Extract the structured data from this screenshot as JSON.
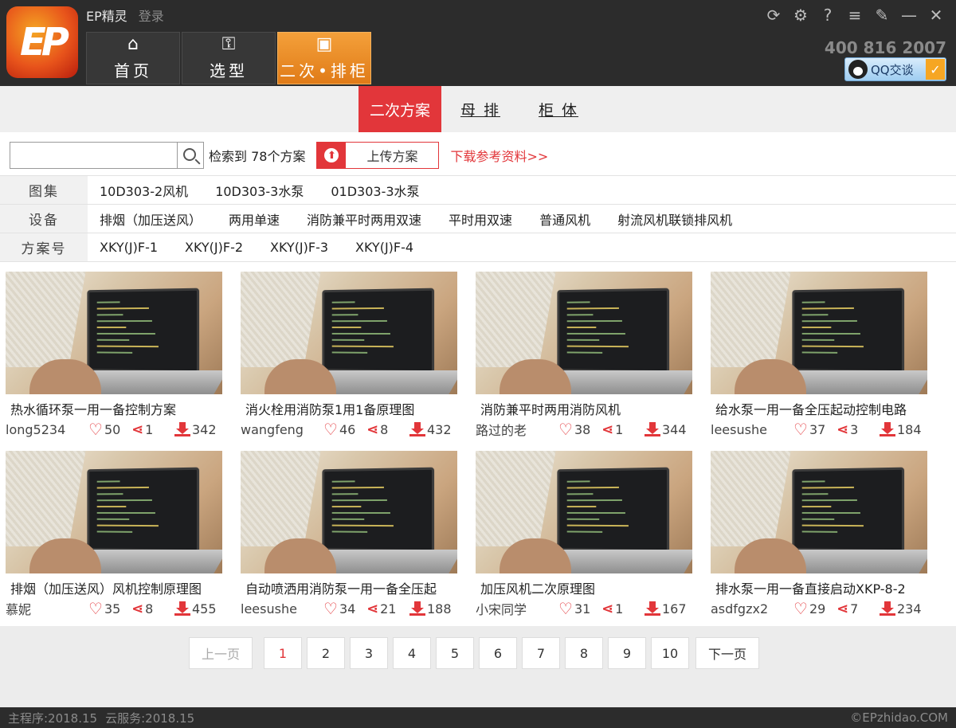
{
  "app": {
    "title": "EP精灵",
    "login": "登录",
    "logo_text": "EP",
    "hotline": "400 816 2007",
    "qq_label": "QQ交谈"
  },
  "window_controls": [
    {
      "name": "refresh-icon",
      "glyph": "⟳"
    },
    {
      "name": "settings-icon",
      "glyph": "⚙"
    },
    {
      "name": "help-icon",
      "glyph": "?"
    },
    {
      "name": "menu-dropdown-icon",
      "glyph": "≡"
    },
    {
      "name": "pin-icon",
      "glyph": "✎"
    },
    {
      "name": "minimize-icon",
      "glyph": "—"
    },
    {
      "name": "close-icon",
      "glyph": "✕"
    }
  ],
  "nav_tabs": [
    {
      "icon": "home-icon",
      "glyph": "⌂",
      "label": "首页"
    },
    {
      "icon": "selection-icon",
      "glyph": "⚿",
      "label": "选型"
    },
    {
      "icon": "cabinet-icon",
      "glyph": "▣",
      "label": "二次•排柜",
      "active": true
    }
  ],
  "sub_tabs": [
    {
      "label": "二次方案",
      "active": true
    },
    {
      "label": "母 排"
    },
    {
      "label": "柜 体"
    }
  ],
  "search": {
    "value": "",
    "placeholder": "",
    "result_count": "检索到 78个方案"
  },
  "upload_label": "上传方案",
  "download_link": "下载参考资料>>",
  "filters": [
    {
      "label": "图集",
      "options": [
        "10D303-2风机",
        "10D303-3水泵",
        "01D303-3水泵"
      ]
    },
    {
      "label": "设备",
      "options": [
        "排烟（加压送风）",
        "两用单速",
        "消防兼平时两用双速",
        "平时用双速",
        "普通风机",
        "射流风机联锁排风机"
      ]
    },
    {
      "label": "方案号",
      "options": [
        "XKY(J)F-1",
        "XKY(J)F-2",
        "XKY(J)F-3",
        "XKY(J)F-4"
      ]
    }
  ],
  "cards": [
    {
      "title": "热水循环泵一用一备控制方案",
      "author": "long5234",
      "likes": "50",
      "shares": "1",
      "downloads": "342"
    },
    {
      "title": "消火栓用消防泵1用1备原理图",
      "author": "wangfeng",
      "likes": "46",
      "shares": "8",
      "downloads": "432"
    },
    {
      "title": "消防兼平时两用消防风机",
      "author": "路过的老",
      "likes": "38",
      "shares": "1",
      "downloads": "344"
    },
    {
      "title": "给水泵一用一备全压起动控制电路",
      "author": "leesushe",
      "likes": "37",
      "shares": "3",
      "downloads": "184"
    },
    {
      "title": "排烟（加压送风）风机控制原理图",
      "author": "慕妮",
      "likes": "35",
      "shares": "8",
      "downloads": "455"
    },
    {
      "title": "自动喷洒用消防泵一用一备全压起",
      "author": "leesushe",
      "likes": "34",
      "shares": "21",
      "downloads": "188"
    },
    {
      "title": "加压风机二次原理图",
      "author": "小宋同学",
      "likes": "31",
      "shares": "1",
      "downloads": "167"
    },
    {
      "title": "排水泵一用一备直接启动XKP-8-2",
      "author": "asdfgzx2",
      "likes": "29",
      "shares": "7",
      "downloads": "234"
    }
  ],
  "pagination": {
    "prev": "上一页",
    "next": "下一页",
    "pages": [
      "1",
      "2",
      "3",
      "4",
      "5",
      "6",
      "7",
      "8",
      "9",
      "10"
    ],
    "current": "1"
  },
  "status": {
    "program_version": "主程序:2018.15",
    "cloud_version": "云服务:2018.15",
    "copyright": "©EPzhidao.COM"
  },
  "colors": {
    "accent_red": "#e2363a",
    "active_orange": "#e07b18",
    "dark_bar": "#2c2c2c"
  }
}
